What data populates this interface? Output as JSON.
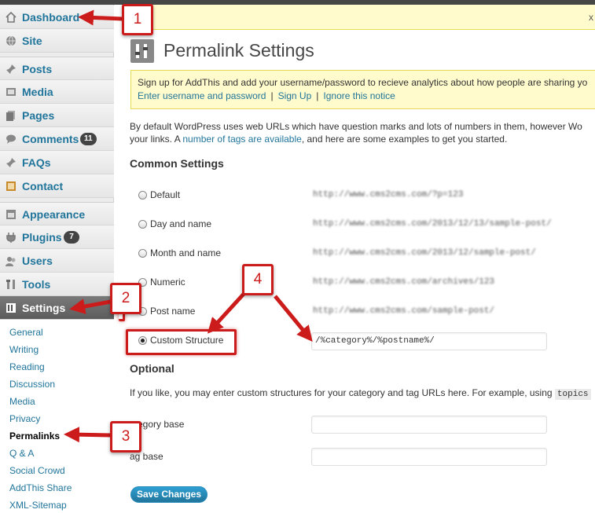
{
  "sidebar": {
    "menu": [
      {
        "label": "Dashboard",
        "icon": "home-icon"
      },
      {
        "label": "Site",
        "icon": "globe-icon"
      },
      {
        "label": "Posts",
        "icon": "pin-icon"
      },
      {
        "label": "Media",
        "icon": "media-icon"
      },
      {
        "label": "Pages",
        "icon": "pages-icon"
      },
      {
        "label": "Comments",
        "icon": "comment-icon",
        "badge": "11"
      },
      {
        "label": "FAQs",
        "icon": "pin-icon"
      },
      {
        "label": "Contact",
        "icon": "contact-icon"
      },
      {
        "label": "Appearance",
        "icon": "appearance-icon"
      },
      {
        "label": "Plugins",
        "icon": "plugin-icon",
        "badge": "7"
      },
      {
        "label": "Users",
        "icon": "users-icon"
      },
      {
        "label": "Tools",
        "icon": "tools-icon"
      },
      {
        "label": "Settings",
        "icon": "settings-icon"
      }
    ],
    "submenu": [
      "General",
      "Writing",
      "Reading",
      "Discussion",
      "Media",
      "Privacy",
      "Permalinks",
      "Q & A",
      "Social Crowd",
      "AddThis Share",
      "XML-Sitemap"
    ]
  },
  "top_notice": {
    "close": "x"
  },
  "page": {
    "title": "Permalink Settings"
  },
  "addthis_notice": {
    "line1": "Sign up for AddThis and add your username/password to recieve analytics about how people are sharing yo",
    "link_enter": "Enter username and password",
    "link_signup": "Sign Up",
    "link_ignore": "Ignore this notice",
    "separator": "|"
  },
  "intro": {
    "line1": "By default WordPress uses web URLs which have question marks and lots of numbers in them, however Wo",
    "line2_before": "your links. A ",
    "line2_link": "number of tags are available",
    "line2_after": ", and here are some examples to get you started."
  },
  "common_settings": {
    "heading": "Common Settings",
    "options": [
      {
        "label": "Default",
        "example": "http://www.cms2cms.com/?p=123",
        "checked": false
      },
      {
        "label": "Day and name",
        "example": "http://www.cms2cms.com/2013/12/13/sample-post/",
        "checked": false
      },
      {
        "label": "Month and name",
        "example": "http://www.cms2cms.com/2013/12/sample-post/",
        "checked": false
      },
      {
        "label": "Numeric",
        "example": "http://www.cms2cms.com/archives/123",
        "checked": false
      },
      {
        "label": "Post name",
        "example": "http://www.cms2cms.com/sample-post/",
        "checked": false
      },
      {
        "label": "Custom Structure",
        "example": "",
        "checked": true
      }
    ],
    "custom_value": "/%category%/%postname%/"
  },
  "optional": {
    "heading": "Optional",
    "desc_before": "If you like, you may enter custom structures for your category and tag URLs here. For example, using ",
    "desc_code": "topics",
    "category_label": "ategory base",
    "tag_label": "ag base",
    "category_value": "",
    "tag_value": ""
  },
  "save_label": "Save Changes",
  "annotations": [
    "1",
    "2",
    "3",
    "4"
  ],
  "colors": {
    "annotation_red": "#cc1b1b",
    "link_blue": "#21759b",
    "notice_yellow": "#fffbcc"
  }
}
